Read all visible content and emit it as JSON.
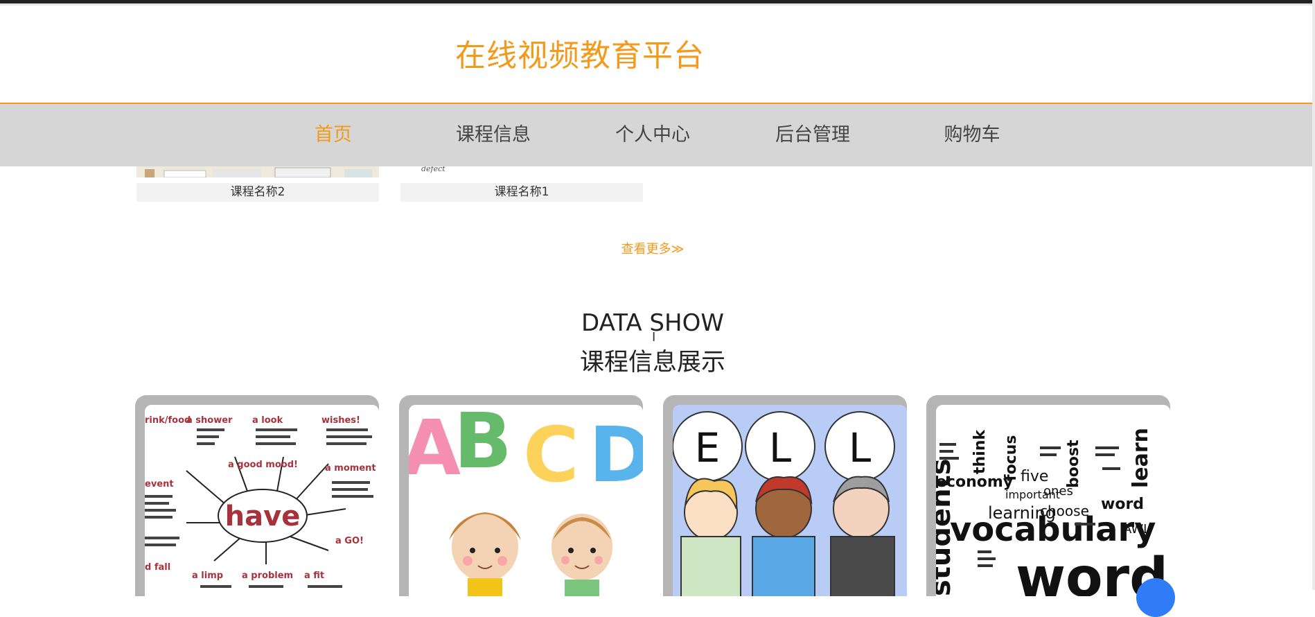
{
  "site": {
    "title": "在线视频教育平台"
  },
  "nav": {
    "items": [
      {
        "label": "首页",
        "active": true
      },
      {
        "label": "课程信息",
        "active": false
      },
      {
        "label": "个人中心",
        "active": false
      },
      {
        "label": "后台管理",
        "active": false
      },
      {
        "label": "购物车",
        "active": false
      }
    ]
  },
  "courses": {
    "items": [
      {
        "name": "课程名称2",
        "thumb_text": ""
      },
      {
        "name": "课程名称1",
        "thumb_text": "defect"
      }
    ],
    "more_label": "查看更多≫"
  },
  "data_show": {
    "title_en": "DATA SHOW",
    "title_cn": "课程信息展示",
    "cards": [
      {
        "image": "have-word-map",
        "center_word": "have",
        "labels": [
          "rink/food",
          "a shower",
          "a look",
          "wishes!",
          "a good mood!",
          "event",
          "a moment",
          "a GO!",
          "d fall",
          "a limp",
          "a problem",
          "a fit"
        ]
      },
      {
        "image": "abc-kids",
        "letters": [
          "A",
          "B",
          "C",
          "D"
        ]
      },
      {
        "image": "ell-kids",
        "letters": [
          "E",
          "L",
          "L"
        ]
      },
      {
        "image": "vocabulary-word-cloud",
        "words": [
          "vocabulary",
          "words",
          "learning",
          "economy",
          "students",
          "important",
          "choose",
          "boost",
          "word",
          "learn",
          "five",
          "ones",
          "focus",
          "think",
          "AWL"
        ]
      }
    ]
  },
  "colors": {
    "accent": "#f29a1b",
    "nav_bg": "#d6d6d6",
    "card_frame": "#b5b5b5"
  }
}
